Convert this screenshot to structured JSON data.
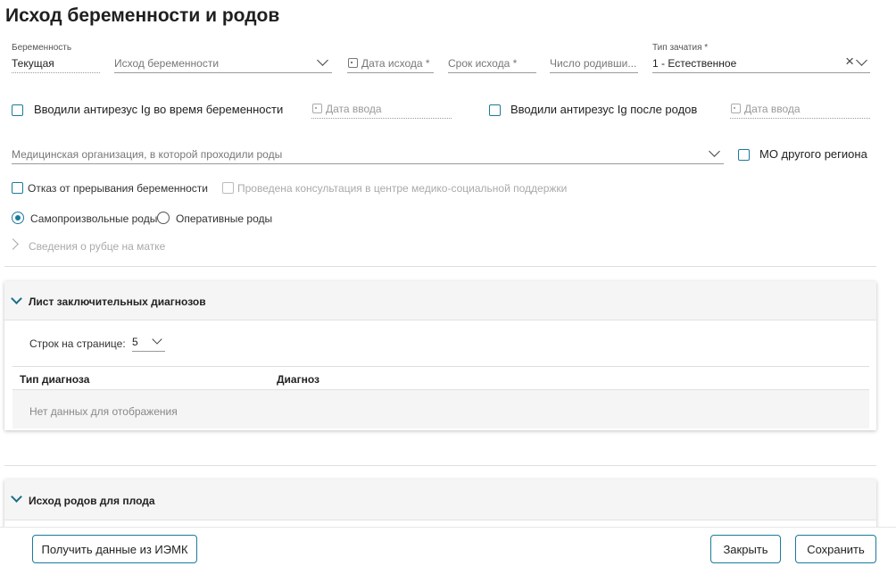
{
  "page": {
    "title": "Исход беременности и родов"
  },
  "form": {
    "pregnancy": {
      "label": "Беременность",
      "value": "Текущая"
    },
    "outcome": {
      "placeholder": "Исход беременности"
    },
    "outcome_date": {
      "placeholder": "Дата исхода *"
    },
    "outcome_term": {
      "placeholder": "Срок исхода *"
    },
    "born_count": {
      "placeholder": "Число родивши..."
    },
    "conception": {
      "label": "Тип зачатия *",
      "value": "1 - Естественное"
    },
    "antirhesus_during": {
      "label": "Вводили антирезус Ig во время беременности",
      "checked": false
    },
    "antirhesus_during_date": {
      "placeholder": "Дата ввода"
    },
    "antirhesus_after": {
      "label": "Вводили антирезус Ig после родов",
      "checked": false
    },
    "antirhesus_after_date": {
      "placeholder": "Дата ввода"
    },
    "med_org": {
      "placeholder": "Медицинская организация, в которой проходили роды"
    },
    "mo_other_region": {
      "label": "МО другого региона",
      "checked": false
    },
    "refusal_termination": {
      "label": "Отказ от прерывания беременности",
      "checked": false
    },
    "consultation": {
      "label": "Проведена консультация в центре медико-социальной поддержки",
      "checked": false,
      "disabled": true
    },
    "delivery_type": {
      "options": [
        "Самопроизвольные роды",
        "Оперативные роды"
      ],
      "selected": "Самопроизвольные роды"
    },
    "scar_info": {
      "label": "Сведения о рубце на матке"
    }
  },
  "diagnoses": {
    "title": "Лист заключительных диагнозов",
    "rows_per_page_label": "Строк на странице:",
    "rows_per_page_value": "5",
    "columns": [
      "Тип диагноза",
      "Диагноз"
    ],
    "empty_text": "Нет данных для отображения"
  },
  "fetal_outcome": {
    "title": "Исход родов для плода"
  },
  "footer": {
    "get_data_button": "Получить данные из ИЭМК",
    "close_button": "Закрыть",
    "save_button": "Сохранить"
  },
  "colors": {
    "accent": "#1a7a9c",
    "chevron": "#1a6d8a"
  },
  "icons": [
    "calendar-icon",
    "chevron-down-icon",
    "clear-icon",
    "chevron-right-icon"
  ]
}
